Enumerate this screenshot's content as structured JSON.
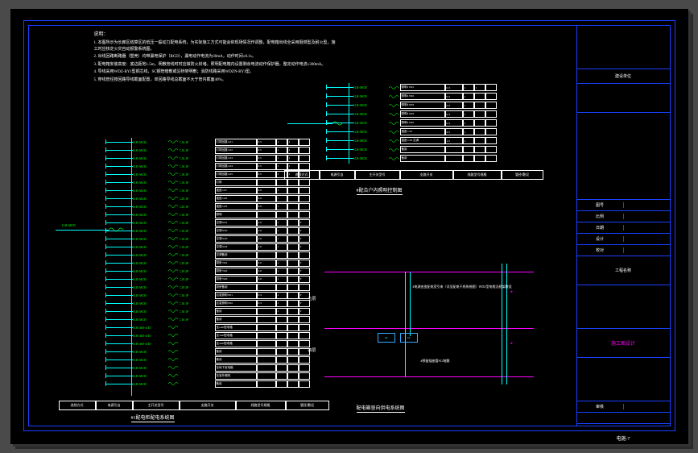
{
  "notes": {
    "heading": "说明：",
    "lines": [
      "1. 本图所示为长廊区结算区的低压一般动力配电系统，为实际施工方式可能会依现场情况作调整，配电箱出线全采用阻燃型及耐火型，施工时应核定火灾自动报警系统图。",
      "2. 出线回路断路器（塑壳）均带漏电保护（RCD），漏电动作电流为30mA，动作时间≤0.1s。",
      "3. 配电箱安装高度：底边距地1.5m，明敷管线时时应做防火封堵。照明配电箱内设置剩余电流动作保护器，整定动作电流≤300mA。",
      "4. 导线采用WDZ-BYJ型铜芯线，SC钢管暗敷或沿桥架明敷；消防线路采用WDZN-BYJ型。",
      "5. 穿线管径按回路导线截面配置，单回路导线总截面不大于管内截面40%。"
    ]
  },
  "main_table": {
    "title": "#1配电柜配电系统图",
    "feeder": {
      "breaker": "1LR-MCB"
    },
    "header": [
      "进线方式",
      "电源引自",
      "主开关型号",
      "支路开关",
      "线路型号规格",
      "管径/敷设"
    ],
    "rows": [
      {
        "brk": "1LR-MCB",
        "sw": "C16 1P",
        "desc": "灯带回路 L01",
        "kw": "0.5",
        "a": "1",
        "b": "1",
        "c": ""
      },
      {
        "brk": "1LR-MCB",
        "sw": "C16 1P",
        "desc": "灯带回路 L02",
        "kw": "0.5",
        "a": "1",
        "b": "1",
        "c": ""
      },
      {
        "brk": "1LR-MCB",
        "sw": "C16 1P",
        "desc": "灯带回路 L03",
        "kw": "0.5",
        "a": "1",
        "b": "1",
        "c": ""
      },
      {
        "brk": "1LR-MCB",
        "sw": "C16 1P",
        "desc": "灯带回路 L04",
        "kw": "0.5",
        "a": "1",
        "b": "1",
        "c": ""
      },
      {
        "brk": "1LR-MCB",
        "sw": "C16 1P",
        "desc": "灯带回路 L05",
        "kw": "0.5",
        "a": "1",
        "b": "1",
        "c": ""
      },
      {
        "brk": "1LR-MCB",
        "sw": "C16 1P",
        "desc": "灯带",
        "kw": "",
        "a": "",
        "b": "",
        "c": ""
      },
      {
        "brk": "1LR-MCB",
        "sw": "C16 1P",
        "desc": "插座 L07",
        "kw": "0.8",
        "a": "1",
        "b": "",
        "c": ""
      },
      {
        "brk": "1LR-MCB",
        "sw": "C20 1P",
        "desc": "插座 L08",
        "kw": "0.8",
        "a": "1",
        "b": "",
        "c": ""
      },
      {
        "brk": "1LR-MCB",
        "sw": "C20 1P",
        "desc": "插座 L09",
        "kw": "0.8",
        "a": "1",
        "b": "",
        "c": ""
      },
      {
        "brk": "1LR-MCB",
        "sw": "C16 1P",
        "desc": "照明",
        "kw": "",
        "a": "",
        "b": "",
        "c": ""
      },
      {
        "brk": "1LR-MCB",
        "sw": "C16 2P",
        "desc": "空调 K01",
        "kw": "2.0",
        "a": "1",
        "b": "",
        "c": "T"
      },
      {
        "brk": "1LR-MCB",
        "sw": "C16 2P",
        "desc": "空调 K02",
        "kw": "2.0",
        "a": "1",
        "b": "",
        "c": "T"
      },
      {
        "brk": "1LR-MCB",
        "sw": "C16 2P",
        "desc": "空调 K03",
        "kw": "2.0",
        "a": "1",
        "b": "",
        "c": "T"
      },
      {
        "brk": "1LR-MCB",
        "sw": "C16 2P",
        "desc": "空调 K04",
        "kw": "2.0",
        "a": "1",
        "b": "",
        "c": "T"
      },
      {
        "brk": "1LR-MCB",
        "sw": "C16 2P",
        "desc": "空调备用",
        "kw": "",
        "a": "",
        "b": "",
        "c": ""
      },
      {
        "brk": "1LR-MCB",
        "sw": "C20 2P",
        "desc": "厨房 N01",
        "kw": "3.0",
        "a": "1",
        "b": "",
        "c": "T"
      },
      {
        "brk": "1LR-MCB",
        "sw": "C20 2P",
        "desc": "厨房 N02",
        "kw": "3.0",
        "a": "1",
        "b": "",
        "c": "T"
      },
      {
        "brk": "1LR-MCB",
        "sw": "C20 2P",
        "desc": "厨房 N03",
        "kw": "3.0",
        "a": "1",
        "b": "",
        "c": "T"
      },
      {
        "brk": "1LR-MCB",
        "sw": "C20 2P",
        "desc": "厨房备用",
        "kw": "",
        "a": "",
        "b": "",
        "c": ""
      },
      {
        "brk": "1LR-MCB",
        "sw": "C16 1P",
        "desc": "应急照明 E01",
        "kw": "0.3",
        "a": "1",
        "b": "",
        "c": "T"
      },
      {
        "brk": "1LR-MCB",
        "sw": "C16 1P",
        "desc": "应急照明 E02",
        "kw": "0.3",
        "a": "1",
        "b": "",
        "c": "T"
      },
      {
        "brk": "1LR-MCB",
        "sw": "C16 1P",
        "desc": "备用",
        "kw": "",
        "a": "1",
        "b": "",
        "c": "T"
      },
      {
        "brk": "1LR-MCB",
        "sw": "C16 1P",
        "desc": "备用",
        "kw": "",
        "a": "",
        "b": "",
        "c": ""
      },
      {
        "brk": "1LR-460-4/40",
        "sw": "",
        "desc": "至2AP配电箱",
        "kw": "",
        "a": "",
        "b": "",
        "c": ""
      },
      {
        "brk": "1LR-460-4/40",
        "sw": "",
        "desc": "至3AP配电箱",
        "kw": "",
        "a": "",
        "b": "",
        "c": ""
      },
      {
        "brk": "1LR-460-4/40",
        "sw": "",
        "desc": "至4AP配电箱",
        "kw": "",
        "a": "",
        "b": "",
        "c": ""
      },
      {
        "brk": "1LR-MCB",
        "sw": "",
        "desc": "备用",
        "kw": "",
        "a": "",
        "b": "",
        "c": ""
      },
      {
        "brk": "1LR-MCB",
        "sw": "",
        "desc": "备用",
        "kw": "",
        "a": "",
        "b": "",
        "c": ""
      },
      {
        "brk": "1LR-MCB",
        "sw": "",
        "desc": "至地下室电箱",
        "kw": "",
        "a": "",
        "b": "",
        "c": ""
      },
      {
        "brk": "1LR-MCB",
        "sw": "",
        "desc": "至室外照明",
        "kw": "",
        "a": "",
        "b": "",
        "c": ""
      },
      {
        "brk": "1LR-MCB",
        "sw": "",
        "desc": "备用",
        "kw": "",
        "a": "",
        "b": "",
        "c": ""
      }
    ]
  },
  "sub_table": {
    "title": "#配合户内照明控制图",
    "feeder": {
      "breaker": "1LR-MCB"
    },
    "header": [
      "进线方式",
      "电源引自",
      "主开关型号",
      "支路开关",
      "线路型号规格",
      "管径/敷设"
    ],
    "rows": [
      {
        "brk": "1LR-MCB",
        "desc": "照明1 N01",
        "kw": "0.3",
        "a": "1",
        "b": "1",
        "c": ""
      },
      {
        "brk": "1LR-MCB",
        "desc": "照明2 N02",
        "kw": "0.3",
        "a": "1",
        "b": "",
        "c": ""
      },
      {
        "brk": "1LR-MCB",
        "desc": "照明3 N03",
        "kw": "0.3",
        "a": "1",
        "b": "",
        "c": ""
      },
      {
        "brk": "1LR-MCB",
        "desc": "照明4 N04",
        "kw": "0.3",
        "a": "1",
        "b": "",
        "c": ""
      },
      {
        "brk": "1LR-MCB",
        "desc": "照明5 N05",
        "kw": "0.3",
        "a": "1",
        "b": "",
        "c": ""
      },
      {
        "brk": "1LR-MCB",
        "desc": "插座 C01",
        "kw": "0.5",
        "a": "1",
        "b": "",
        "c": ""
      },
      {
        "brk": "1LR-MCB",
        "desc": "插座 C02 空调",
        "kw": "1.5",
        "a": "1",
        "b": "",
        "c": ""
      },
      {
        "brk": "1LR-MCB",
        "desc": "备用",
        "kw": "",
        "a": "",
        "b": "",
        "c": ""
      },
      {
        "brk": "1LR-MCB",
        "desc": "备用",
        "kw": "",
        "a": "",
        "b": "",
        "c": ""
      }
    ]
  },
  "riser": {
    "title": "配电箱竖向供电系统图",
    "floors": [
      "五层",
      "四层"
    ],
    "box_labels": [
      "AP",
      "AP"
    ],
    "annotations": [
      "#电源由变配电室引来（详见配电干线系统图）WDZ型电缆沿桥架敷设",
      "#预留插座管SC/暗敷"
    ]
  },
  "title_block": {
    "project_name": "工程名称",
    "owner": "建设单位",
    "rows": [
      {
        "k": "图号",
        "v": ""
      },
      {
        "k": "比例",
        "v": ""
      },
      {
        "k": "日期",
        "v": ""
      },
      {
        "k": "设计",
        "v": ""
      },
      {
        "k": "校对",
        "v": ""
      },
      {
        "k": "审核",
        "v": ""
      }
    ],
    "drawing_title": "电施-7",
    "stage": "施工图设计",
    "note": ""
  }
}
